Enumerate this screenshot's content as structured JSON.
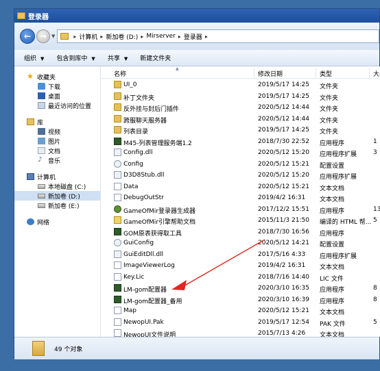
{
  "window": {
    "title": "登录器"
  },
  "address": {
    "crumbs": [
      "计算机",
      "新加卷 (D:)",
      "Mirserver",
      "登录器"
    ]
  },
  "toolbar": {
    "organize": "组织",
    "include_library": "包含到库中",
    "share": "共享",
    "new_folder": "新建文件夹"
  },
  "nav": {
    "favorites": "收藏夹",
    "downloads": "下载",
    "desktop": "桌面",
    "recent": "最近访问的位置",
    "library": "库",
    "videos": "视频",
    "pictures": "图片",
    "documents": "文档",
    "music": "音乐",
    "computer": "计算机",
    "drive_c": "本地磁盘 (C:)",
    "drive_d": "新加卷 (D:)",
    "drive_e": "新加卷 (E:)",
    "network": "网络"
  },
  "columns": {
    "name": "名称",
    "date": "修改日期",
    "type": "类型",
    "size": "大小"
  },
  "files": [
    {
      "name": "UI_0",
      "date": "2019/5/17 14:25",
      "type": "文件夹",
      "size": "",
      "icon": "folder"
    },
    {
      "name": "补丁文件夹",
      "date": "2019/5/17 14:25",
      "type": "文件夹",
      "size": "",
      "icon": "folder"
    },
    {
      "name": "反外挂与封后门插件",
      "date": "2020/5/12 14:44",
      "type": "文件夹",
      "size": "",
      "icon": "folder"
    },
    {
      "name": "跨服聊天服务器",
      "date": "2020/5/12 14:44",
      "type": "文件夹",
      "size": "",
      "icon": "folder"
    },
    {
      "name": "列表目录",
      "date": "2019/5/17 14:25",
      "type": "文件夹",
      "size": "",
      "icon": "folder"
    },
    {
      "name": "M45-列表管理服务端1.2",
      "date": "2018/7/30 22:52",
      "type": "应用程序",
      "size": "1",
      "icon": "app-g"
    },
    {
      "name": "Config.dll",
      "date": "2020/5/12 15:20",
      "type": "应用程序扩展",
      "size": "3",
      "icon": "dll"
    },
    {
      "name": "Config",
      "date": "2020/5/12 15:21",
      "type": "配置设置",
      "size": "",
      "icon": "cfg"
    },
    {
      "name": "D3D8Stub.dll",
      "date": "2020/5/12 15:20",
      "type": "应用程序扩展",
      "size": "",
      "icon": "dll"
    },
    {
      "name": "Data",
      "date": "2020/5/12 15:21",
      "type": "文本文档",
      "size": "",
      "icon": "txt"
    },
    {
      "name": "DebugOutStr",
      "date": "2019/4/2 16:31",
      "type": "文本文档",
      "size": "",
      "icon": "txt"
    },
    {
      "name": "GameOfMir登录器生成器",
      "date": "2017/12/2 15:51",
      "type": "应用程序",
      "size": "13",
      "icon": "app-y"
    },
    {
      "name": "GameOfMir引擎帮助文档",
      "date": "2015/11/3 21:50",
      "type": "编译的 HTML 帮...",
      "size": "5",
      "icon": "chm"
    },
    {
      "name": "GOM原表获得取工具",
      "date": "2018/7/30 16:56",
      "type": "应用程序",
      "size": "",
      "icon": "app-g"
    },
    {
      "name": "GuiConfig",
      "date": "2020/5/12 14:21",
      "type": "配置设置",
      "size": "",
      "icon": "cfg"
    },
    {
      "name": "GuiEditDll.dll",
      "date": "2017/5/16 4:33",
      "type": "应用程序扩展",
      "size": "",
      "icon": "dll"
    },
    {
      "name": "ImageViewerLog",
      "date": "2019/4/2 16:31",
      "type": "文本文档",
      "size": "",
      "icon": "txt"
    },
    {
      "name": "Key.Lic",
      "date": "2018/7/16 14:40",
      "type": "LIC 文件",
      "size": "",
      "icon": "txt"
    },
    {
      "name": "LM-gom配置器",
      "date": "2020/3/10 16:35",
      "type": "应用程序",
      "size": "8",
      "icon": "app-g"
    },
    {
      "name": "LM-gom配置器_备用",
      "date": "2020/3/10 16:39",
      "type": "应用程序",
      "size": "8",
      "icon": "app-g"
    },
    {
      "name": "Map",
      "date": "2020/5/12 15:21",
      "type": "文本文档",
      "size": "",
      "icon": "txt"
    },
    {
      "name": "NewopUI.Pak",
      "date": "2019/5/17 12:54",
      "type": "PAK 文件",
      "size": "5",
      "icon": "txt"
    },
    {
      "name": "NewopUI文件说明",
      "date": "2015/7/13 4:26",
      "type": "文本文档",
      "size": "",
      "icon": "txt"
    }
  ],
  "status": {
    "count": "49 个对象"
  },
  "colors": {
    "accent": "#1d4f9e",
    "arrow": "#e0261d",
    "desktop": "#3a6ea5"
  }
}
